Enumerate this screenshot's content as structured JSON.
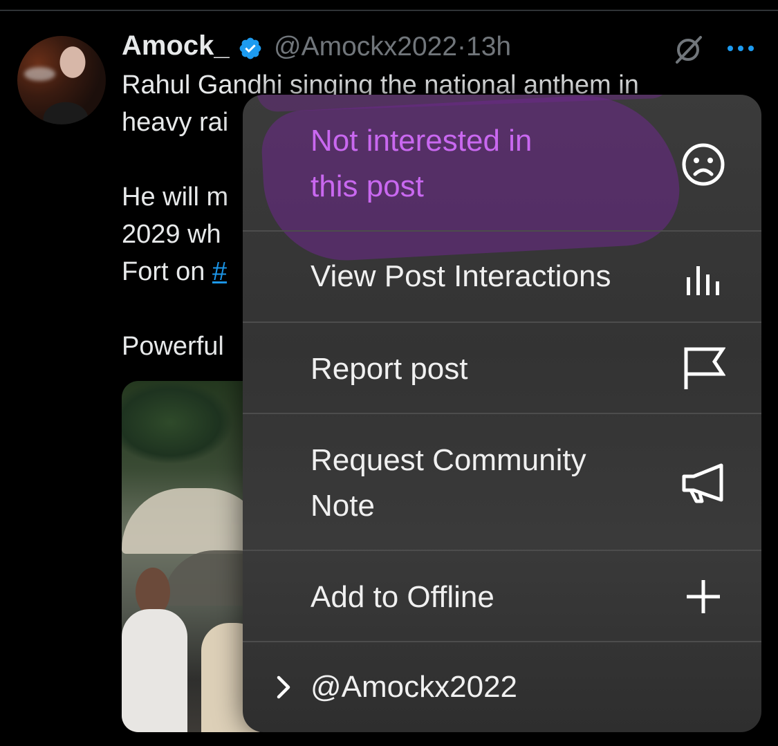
{
  "post": {
    "author_name": "Amock_",
    "handle": "@Amockx2022",
    "separator": "·",
    "time": "13h",
    "text_lines": [
      "Rahul Gandhi singing the national anthem in",
      "heavy rai",
      "He will m",
      "2029 wh",
      "Fort on ",
      "Powerful"
    ],
    "hashtag_fragment": "#"
  },
  "menu": {
    "items": [
      {
        "label_lines": [
          "Not interested in",
          "this post"
        ],
        "icon": "sad-face-icon"
      },
      {
        "label": "View Post Interactions",
        "icon": "bar-chart-icon"
      },
      {
        "label": "Report post",
        "icon": "flag-icon"
      },
      {
        "label_lines": [
          "Request Community",
          "Note"
        ],
        "icon": "megaphone-icon"
      },
      {
        "label": "Add to Offline",
        "icon": "plus-icon"
      },
      {
        "label": "@Amockx2022",
        "icon": "chevron-right-icon"
      }
    ]
  },
  "colors": {
    "background": "#000000",
    "text": "#e7e9ea",
    "muted": "#71767b",
    "link": "#1d9bf0",
    "verified": "#1d9bf0",
    "highlight_text": "#c968f0",
    "menu_bg": "#363636"
  }
}
